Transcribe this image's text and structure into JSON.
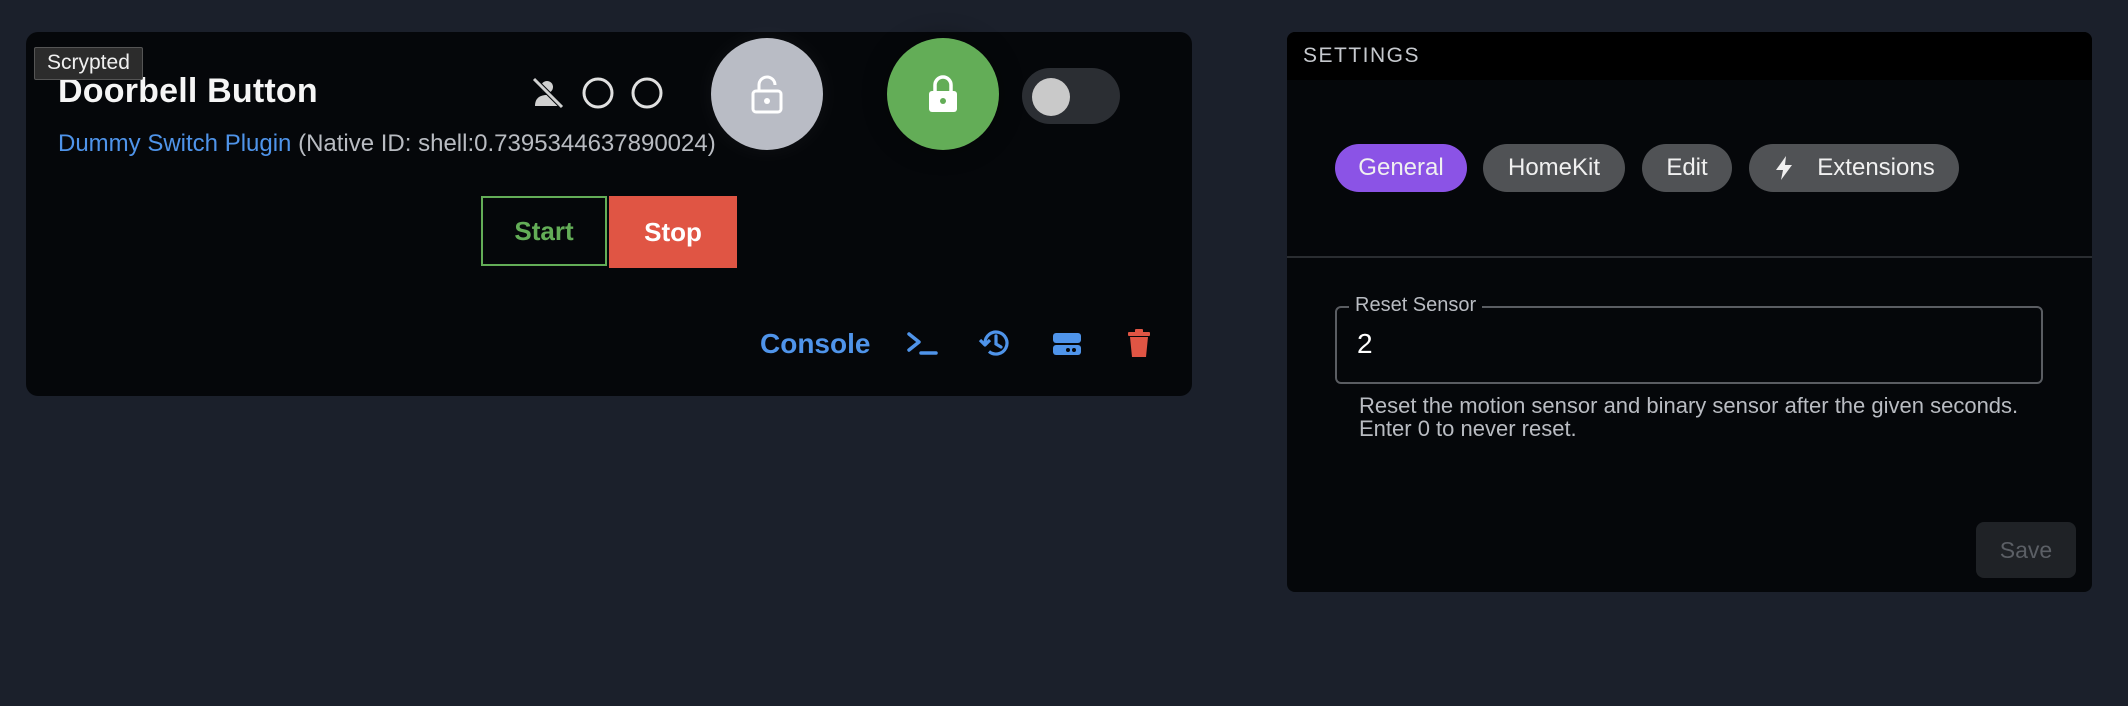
{
  "tooltip": "Scrypted",
  "device": {
    "title": "Doorbell Button",
    "plugin_link": "Dummy Switch Plugin",
    "native_id": "(Native ID: shell:0.7395344637890024)"
  },
  "controls": {
    "start_label": "Start",
    "stop_label": "Stop",
    "console_label": "Console",
    "toggle_on": false
  },
  "icons": {
    "status": [
      "person-off-icon",
      "circle-outline-icon",
      "circle-outline-icon"
    ],
    "locks": [
      "lock-open-icon",
      "lock-closed-icon"
    ],
    "actions": [
      "terminal-icon",
      "history-icon",
      "storage-icon",
      "trash-icon"
    ]
  },
  "colors": {
    "accent_blue": "#4f94ea",
    "green": "#63ad57",
    "red": "#e05544",
    "purple": "#8b53e6"
  },
  "settings": {
    "header": "SETTINGS",
    "tabs": [
      {
        "label": "General",
        "active": true
      },
      {
        "label": "HomeKit",
        "active": false
      },
      {
        "label": "Edit",
        "active": false
      },
      {
        "label": "Extensions",
        "active": false
      }
    ],
    "field": {
      "label": "Reset Sensor",
      "value": "2",
      "help": "Reset the motion sensor and binary sensor after the given seconds. Enter 0 to never reset."
    },
    "save_label": "Save"
  }
}
